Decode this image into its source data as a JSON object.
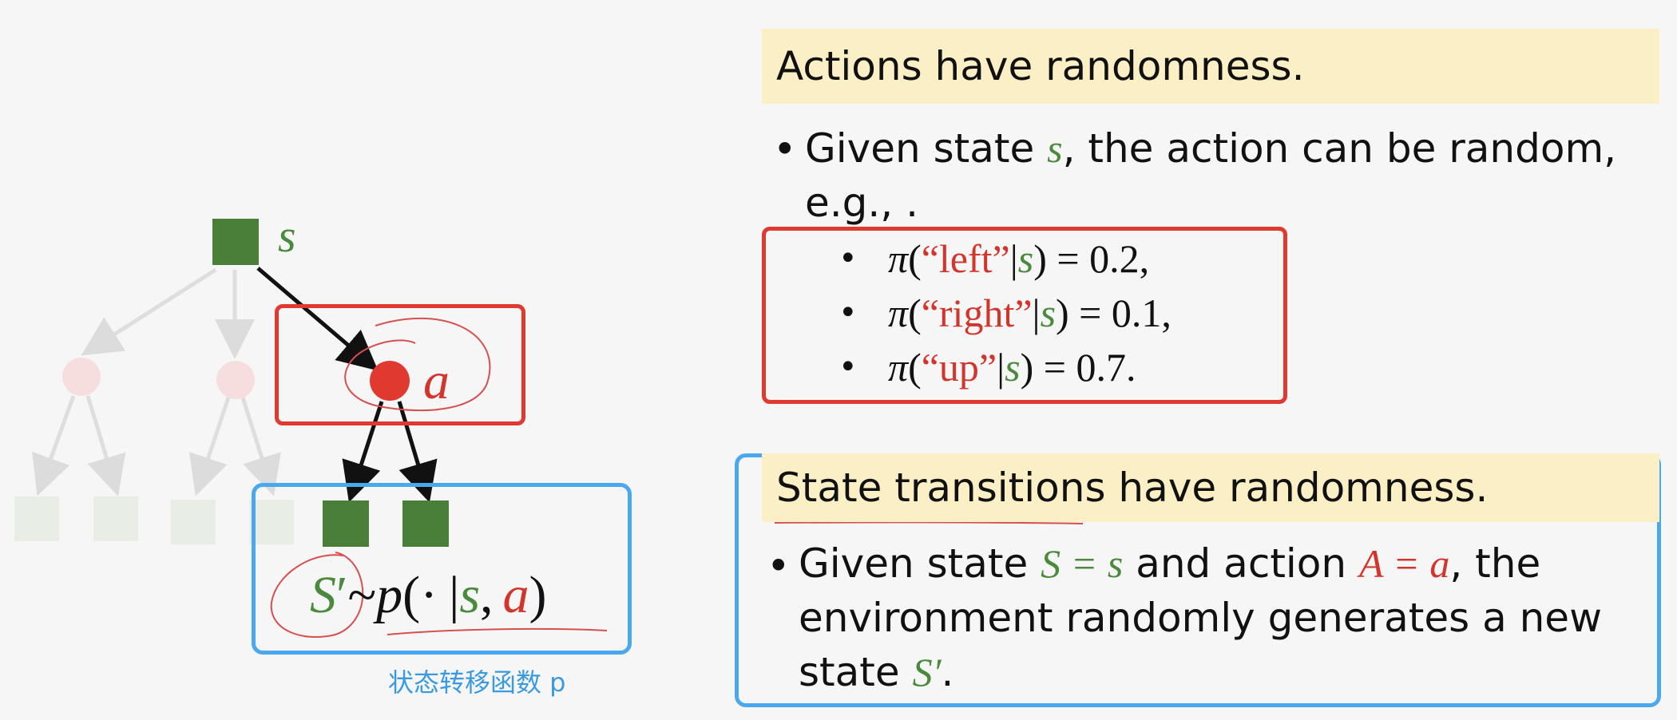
{
  "left_diagram": {
    "state_label": "s",
    "action_label": "a",
    "formula": {
      "next_state": "S",
      "prime": "′",
      "tilde": "~",
      "p": "p",
      "open": "(",
      "dot": "·",
      "bar": "|",
      "s": "s",
      "comma": ",",
      "a": "a",
      "close": ")"
    },
    "caption": "状态转移函数 p"
  },
  "section1": {
    "heading": "Actions have randomness.",
    "bullet_prefix": "Given state ",
    "bullet_var": "s",
    "bullet_suffix": ", the action can be random,",
    "bullet_line2": "e.g., .",
    "policy_items": [
      {
        "pi": "π",
        "open": "(",
        "action": "“left”",
        "bar": "|",
        "state": "s",
        "close": ") = 0.2,"
      },
      {
        "pi": "π",
        "open": "(",
        "action": "“right”",
        "bar": "|",
        "state": "s",
        "close": ") = 0.1,"
      },
      {
        "pi": "π",
        "open": "(",
        "action": "“up”",
        "bar": "|",
        "state": "s",
        "close": ") = 0.7."
      }
    ]
  },
  "section2": {
    "heading": "State transitions have randomness.",
    "line1_prefix": "Given state ",
    "line1_S": "S = s",
    "line1_mid": " and action ",
    "line1_A": "A = a",
    "line1_suffix": ", the",
    "line2": "environment randomly generates a new",
    "line3_prefix": "state ",
    "line3_var": "S′",
    "line3_suffix": "."
  },
  "colors": {
    "state_green": "#4a8a3c",
    "action_red": "#e0392f",
    "highlight_yellow": "#fbefc6",
    "box_blue": "#4aa8ee"
  }
}
